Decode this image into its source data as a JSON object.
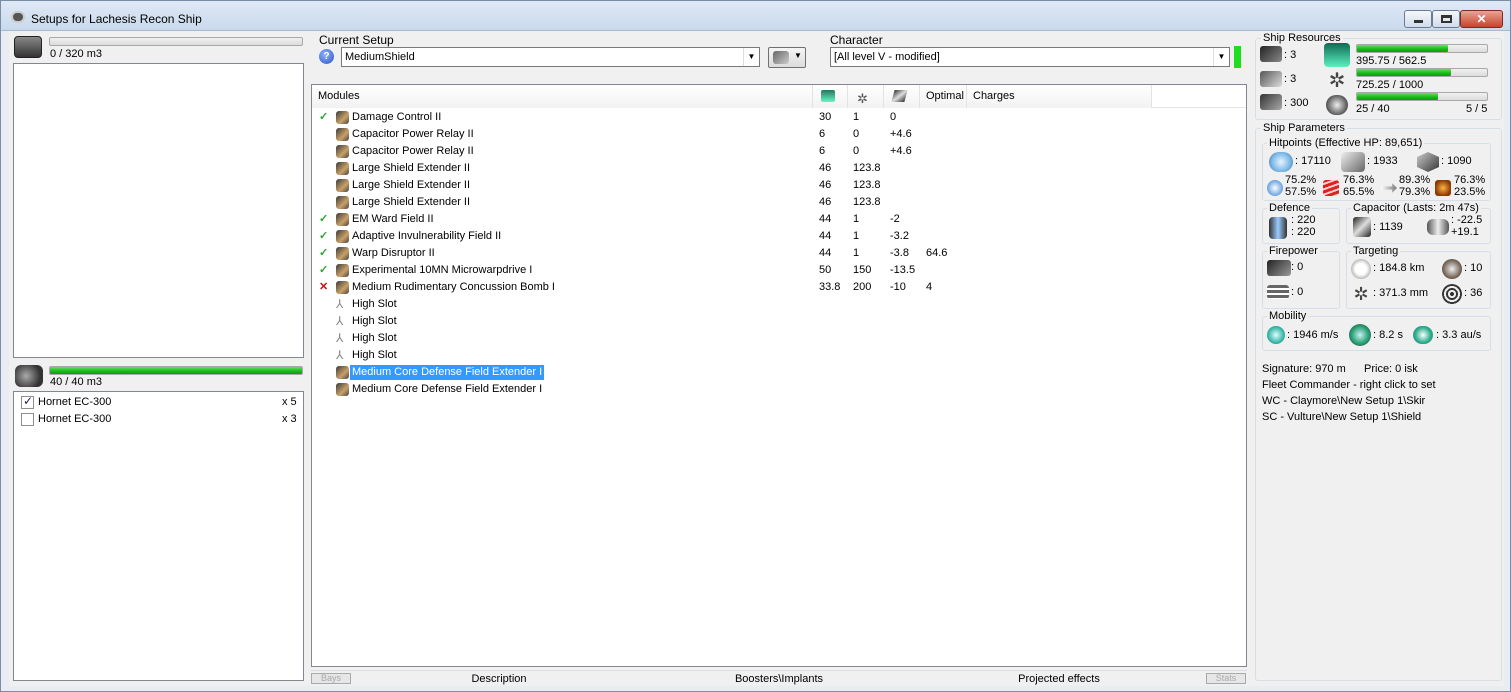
{
  "window": {
    "title": "Setups for Lachesis Recon Ship"
  },
  "cargo": {
    "capacity_text": "0 / 320 m3",
    "fill": 0
  },
  "drones": {
    "capacity_text": "40 / 40 m3",
    "fill": 1.0,
    "items": [
      {
        "name": "Hornet EC-300",
        "qty": "x 5",
        "checked": true
      },
      {
        "name": "Hornet EC-300",
        "qty": "x 3",
        "checked": false
      }
    ]
  },
  "current_setup": {
    "label": "Current Setup",
    "value": "MediumShield"
  },
  "character": {
    "label": "Character",
    "value": "[All level V - modified]"
  },
  "modules_table": {
    "headers": [
      "Modules",
      "",
      "",
      "",
      "Optimal",
      "Charges"
    ],
    "header_icons": [
      "cpu-icon",
      "powergrid-icon",
      "capacitor-icon"
    ],
    "rows": [
      {
        "status": "ok",
        "name": "Damage Control II",
        "cpu": "30",
        "pg": "1",
        "cap": "0",
        "optimal": "",
        "charges": "",
        "selected": false
      },
      {
        "status": "",
        "name": "Capacitor Power Relay II",
        "cpu": "6",
        "pg": "0",
        "cap": "+4.6",
        "optimal": "",
        "charges": "",
        "selected": false
      },
      {
        "status": "",
        "name": "Capacitor Power Relay II",
        "cpu": "6",
        "pg": "0",
        "cap": "+4.6",
        "optimal": "",
        "charges": "",
        "selected": false
      },
      {
        "status": "",
        "name": "Large Shield Extender II",
        "cpu": "46",
        "pg": "123.8",
        "cap": "",
        "optimal": "",
        "charges": "",
        "selected": false
      },
      {
        "status": "",
        "name": "Large Shield Extender II",
        "cpu": "46",
        "pg": "123.8",
        "cap": "",
        "optimal": "",
        "charges": "",
        "selected": false
      },
      {
        "status": "",
        "name": "Large Shield Extender II",
        "cpu": "46",
        "pg": "123.8",
        "cap": "",
        "optimal": "",
        "charges": "",
        "selected": false
      },
      {
        "status": "ok",
        "name": "EM Ward Field II",
        "cpu": "44",
        "pg": "1",
        "cap": "-2",
        "optimal": "",
        "charges": "",
        "selected": false
      },
      {
        "status": "ok",
        "name": "Adaptive Invulnerability Field II",
        "cpu": "44",
        "pg": "1",
        "cap": "-3.2",
        "optimal": "",
        "charges": "",
        "selected": false
      },
      {
        "status": "ok",
        "name": "Warp Disruptor II",
        "cpu": "44",
        "pg": "1",
        "cap": "-3.8",
        "optimal": "64.6",
        "charges": "",
        "selected": false
      },
      {
        "status": "ok",
        "name": "Experimental 10MN Microwarpdrive I",
        "cpu": "50",
        "pg": "150",
        "cap": "-13.5",
        "optimal": "",
        "charges": "",
        "selected": false
      },
      {
        "status": "err",
        "name": "Medium Rudimentary Concussion Bomb I",
        "cpu": "33.8",
        "pg": "200",
        "cap": "-10",
        "optimal": "4",
        "charges": "",
        "selected": false
      },
      {
        "status": "",
        "name": "High Slot",
        "cpu": "",
        "pg": "",
        "cap": "",
        "optimal": "",
        "charges": "",
        "selected": false
      },
      {
        "status": "",
        "name": "High Slot",
        "cpu": "",
        "pg": "",
        "cap": "",
        "optimal": "",
        "charges": "",
        "selected": false
      },
      {
        "status": "",
        "name": "High Slot",
        "cpu": "",
        "pg": "",
        "cap": "",
        "optimal": "",
        "charges": "",
        "selected": false
      },
      {
        "status": "",
        "name": "High Slot",
        "cpu": "",
        "pg": "",
        "cap": "",
        "optimal": "",
        "charges": "",
        "selected": false
      },
      {
        "status": "",
        "name": "Medium Core Defense Field Extender I",
        "cpu": "",
        "pg": "",
        "cap": "",
        "optimal": "",
        "charges": "",
        "selected": true
      },
      {
        "status": "",
        "name": "Medium Core Defense Field Extender I",
        "cpu": "",
        "pg": "",
        "cap": "",
        "optimal": "",
        "charges": "",
        "selected": false
      }
    ]
  },
  "bottom_tabs": {
    "bays": "Bays",
    "description": "Description",
    "boosters": "Boosters\\Implants",
    "projected": "Projected effects",
    "stats": "Stats"
  },
  "ship_resources": {
    "title": "Ship Resources",
    "turret_hardpoints": ": 3",
    "launcher_hardpoints": ": 3",
    "calibration": ": 300",
    "cpu_text": "395.75 / 562.5",
    "cpu_fill": 0.7036,
    "pg_text": "725.25 / 1000",
    "pg_fill": 0.7253,
    "drone_bw_text": "25 / 40",
    "drone_bw_fill": 0.625,
    "drones_active": "5 / 5"
  },
  "ship_parameters": {
    "title": "Ship Parameters",
    "hitpoints": {
      "title": "Hitpoints (Effective HP: 89,651)",
      "shield": ": 17110",
      "armor": ": 1933",
      "structure": ": 1090",
      "resists": [
        {
          "a": "75.2%",
          "b": "57.5%"
        },
        {
          "a": "76.3%",
          "b": "65.5%"
        },
        {
          "a": "89.3%",
          "b": "79.3%"
        },
        {
          "a": "76.3%",
          "b": "23.5%"
        }
      ]
    },
    "defence": {
      "title": "Defence",
      "a": ": 220",
      "b": ": 220"
    },
    "capacitor": {
      "title": "Capacitor (Lasts: 2m 47s)",
      "amount": ": 1139",
      "a": ": -22.5",
      "b": "+19.1"
    },
    "firepower": {
      "title": "Firepower",
      "a": ": 0",
      "b": ": 0"
    },
    "targeting": {
      "title": "Targeting",
      "range": ": 184.8 km",
      "targets": ": 10",
      "resolution": ": 371.3 mm",
      "sensor": ": 36"
    },
    "mobility": {
      "title": "Mobility",
      "speed": ": 1946 m/s",
      "align": ": 8.2 s",
      "warp": ": 3.3 au/s"
    },
    "signature": "Signature: 970 m",
    "price": "Price: 0 isk",
    "fleet_commander": "Fleet Commander - right click to set",
    "wing_commander": "WC - Claymore\\New Setup 1\\Skir",
    "squad_commander": "SC - Vulture\\New Setup 1\\Shield"
  }
}
